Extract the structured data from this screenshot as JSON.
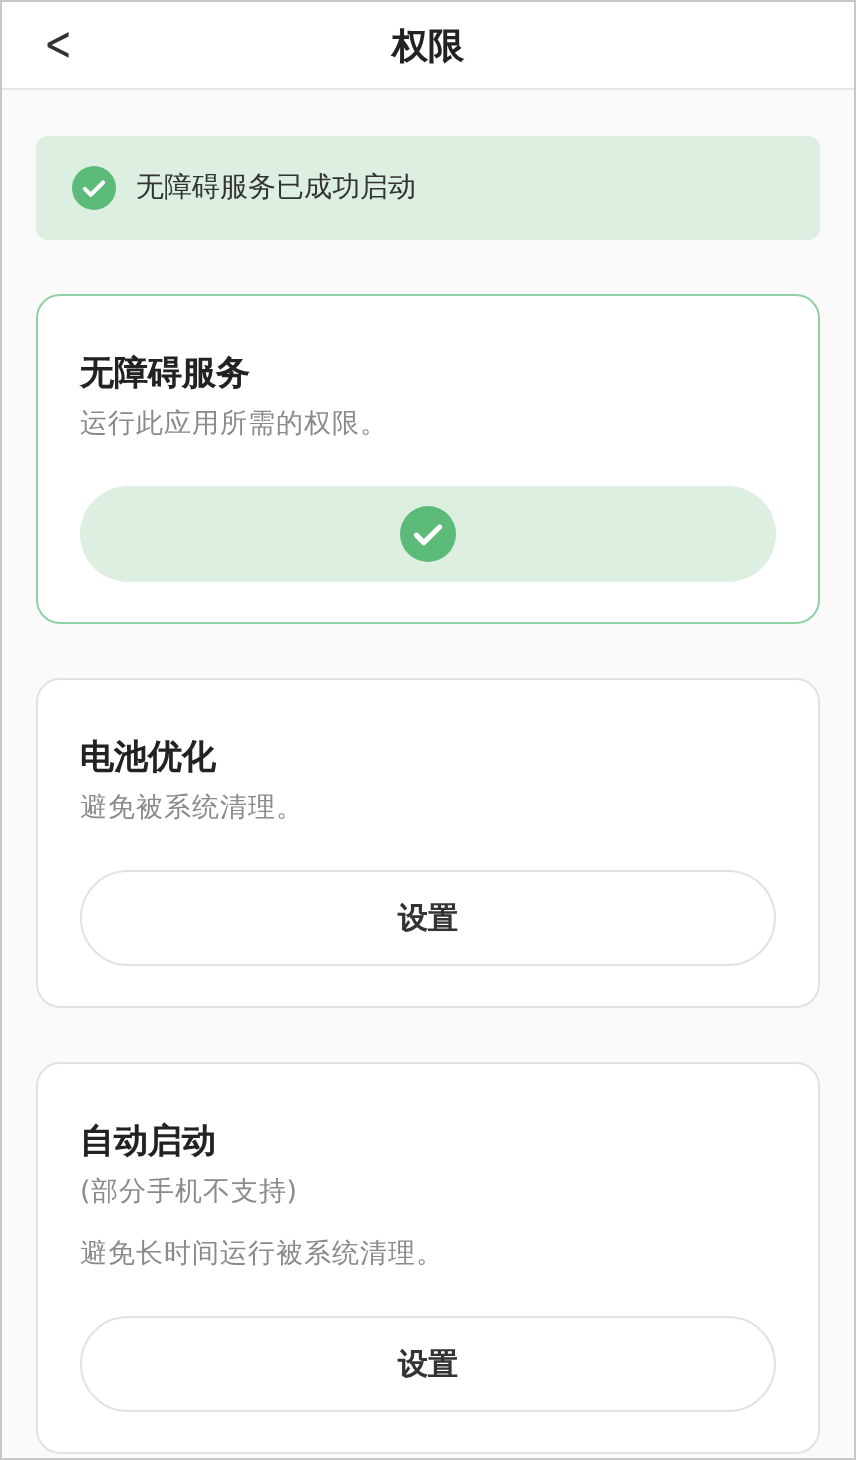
{
  "header": {
    "back": "<",
    "title": "权限"
  },
  "banner": {
    "text": "无障碍服务已成功启动"
  },
  "cards": [
    {
      "title": "无障碍服务",
      "notes": [
        "运行此应用所需的权限。"
      ],
      "granted": true
    },
    {
      "title": "电池优化",
      "notes": [
        "避免被系统清理。"
      ],
      "granted": false,
      "button": "设置"
    },
    {
      "title": "自动启动",
      "notes": [
        "(部分手机不支持)",
        "避免长时间运行被系统清理。"
      ],
      "granted": false,
      "button": "设置"
    }
  ]
}
